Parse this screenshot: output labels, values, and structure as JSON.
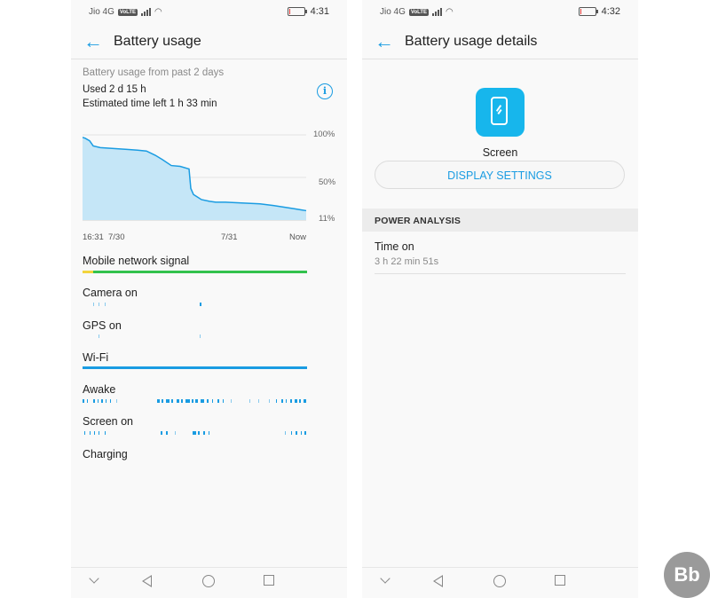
{
  "status_left": {
    "carrier": "Jio 4G",
    "volte": "VoLTE"
  },
  "status_right_left": {
    "time": "4:31",
    "battery_level": 0.12
  },
  "status_right_right": {
    "time": "4:32",
    "battery_level": 0.11
  },
  "left_screen": {
    "title": "Battery usage",
    "subtitle": "Battery usage from past 2 days",
    "used": "Used 2 d 15 h",
    "estimated": "Estimated time left 1 h 33 min",
    "chart_data": {
      "type": "area",
      "y_tick_labels": [
        "100%",
        "50%",
        "11%"
      ],
      "x_tick_labels": [
        "16:31",
        "7/30",
        "7/31",
        "Now"
      ],
      "ylim": [
        0,
        100
      ],
      "x": [
        0,
        3,
        8,
        12,
        20,
        35,
        50,
        62,
        72,
        82,
        90,
        100,
        110,
        120,
        122,
        125,
        128,
        134,
        143,
        150,
        160,
        200,
        215,
        228,
        240,
        246,
        252
      ],
      "values": [
        97,
        96,
        93,
        87,
        85,
        84,
        83,
        82,
        81,
        76,
        71,
        64,
        63,
        60,
        37,
        30,
        28,
        24,
        22,
        21,
        21,
        19,
        17,
        15,
        13,
        12,
        11
      ],
      "x_range": [
        0,
        252
      ],
      "grid": true,
      "color": "#1a9ce2",
      "fill": "#c5e6f7"
    },
    "rows": [
      {
        "label": "Mobile network signal"
      },
      {
        "label": "Camera on"
      },
      {
        "label": "GPS on"
      },
      {
        "label": "Wi-Fi"
      },
      {
        "label": "Awake"
      },
      {
        "label": "Screen on"
      },
      {
        "label": "Charging"
      }
    ],
    "colors": {
      "accent": "#1a9ce2",
      "signal_good": "#33c24d",
      "signal_low": "#f2d43c"
    }
  },
  "right_screen": {
    "title": "Battery usage details",
    "app_name": "Screen",
    "button_label": "DISPLAY SETTINGS",
    "section_header": "POWER ANALYSIS",
    "time_on_label": "Time on",
    "time_on_value": "3 h 22 min 51s",
    "icon_color": "#17b6ec"
  },
  "watermark": "Bb",
  "icons": [
    "back-arrow-icon",
    "info-icon",
    "phone-screen-icon",
    "nav-back-icon",
    "nav-home-icon",
    "nav-recents-icon",
    "nav-down-icon"
  ]
}
